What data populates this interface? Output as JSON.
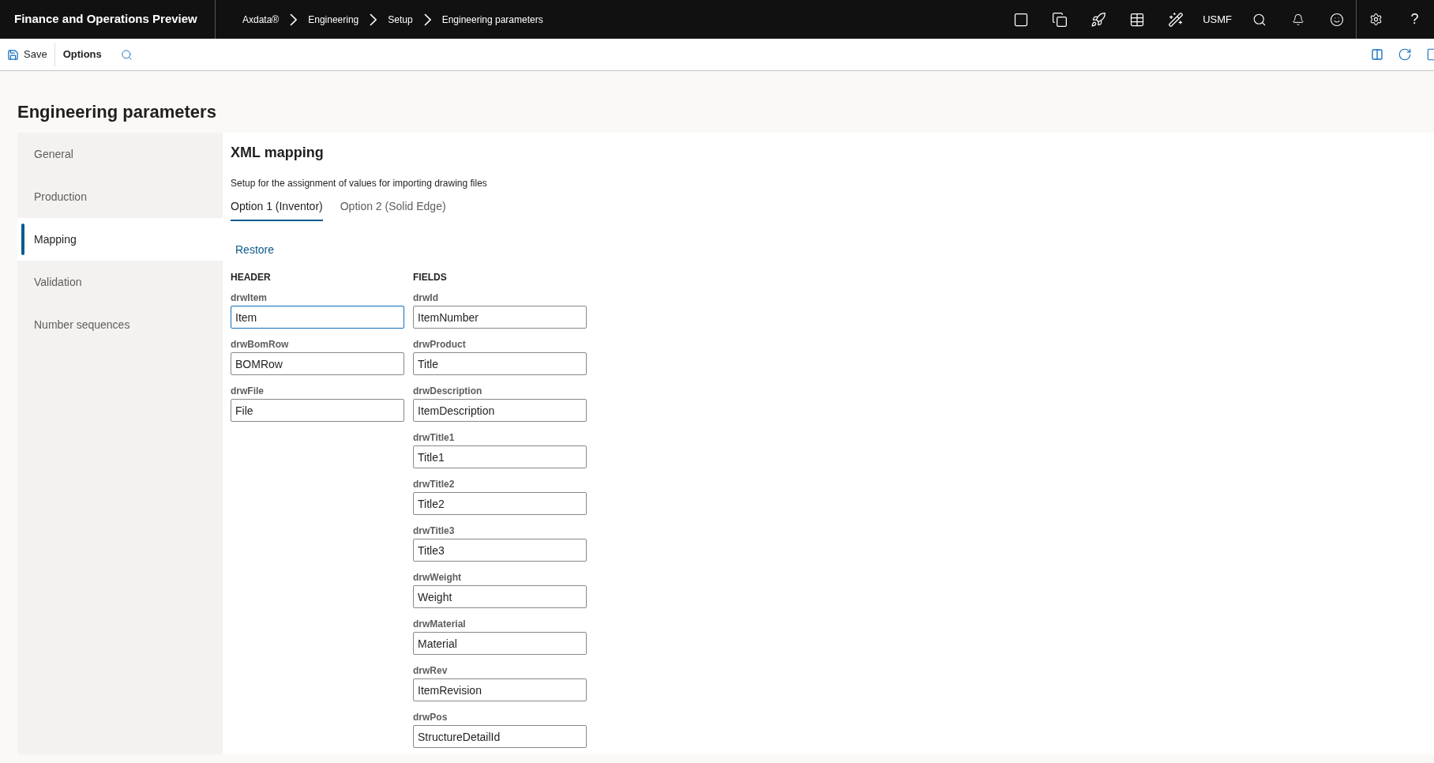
{
  "app_title": "Finance and Operations Preview",
  "breadcrumb": [
    "Axdata®",
    "Engineering",
    "Setup",
    "Engineering parameters"
  ],
  "company": "USMF",
  "help": "?",
  "toolbar": {
    "save": "Save",
    "options": "Options"
  },
  "page_title": "Engineering parameters",
  "sidebar": [
    {
      "label": "General",
      "selected": false
    },
    {
      "label": "Production",
      "selected": false
    },
    {
      "label": "Mapping",
      "selected": true
    },
    {
      "label": "Validation",
      "selected": false
    },
    {
      "label": "Number sequences",
      "selected": false
    }
  ],
  "section_title": "XML mapping",
  "description": "Setup for the assignment of values for importing drawing files",
  "tabs": [
    {
      "label": "Option 1 (Inventor)",
      "selected": true
    },
    {
      "label": "Option 2 (Solid Edge)",
      "selected": false
    }
  ],
  "restore": "Restore",
  "header": {
    "title": "HEADER",
    "fields": [
      {
        "label": "drwItem",
        "value": "Item",
        "focused": true
      },
      {
        "label": "drwBomRow",
        "value": "BOMRow",
        "focused": false
      },
      {
        "label": "drwFile",
        "value": "File",
        "focused": false
      }
    ]
  },
  "fields": {
    "title": "FIELDS",
    "fields": [
      {
        "label": "drwId",
        "value": "ItemNumber",
        "focused": false
      },
      {
        "label": "drwProduct",
        "value": "Title",
        "focused": false
      },
      {
        "label": "drwDescription",
        "value": "ItemDescription",
        "focused": false
      },
      {
        "label": "drwTitle1",
        "value": "Title1",
        "focused": false
      },
      {
        "label": "drwTitle2",
        "value": "Title2",
        "focused": false
      },
      {
        "label": "drwTitle3",
        "value": "Title3",
        "focused": false
      },
      {
        "label": "drwWeight",
        "value": "Weight",
        "focused": false
      },
      {
        "label": "drwMaterial",
        "value": "Material",
        "focused": false
      },
      {
        "label": "drwRev",
        "value": "ItemRevision",
        "focused": false
      },
      {
        "label": "drwPos",
        "value": "StructureDetailId",
        "focused": false
      }
    ]
  }
}
